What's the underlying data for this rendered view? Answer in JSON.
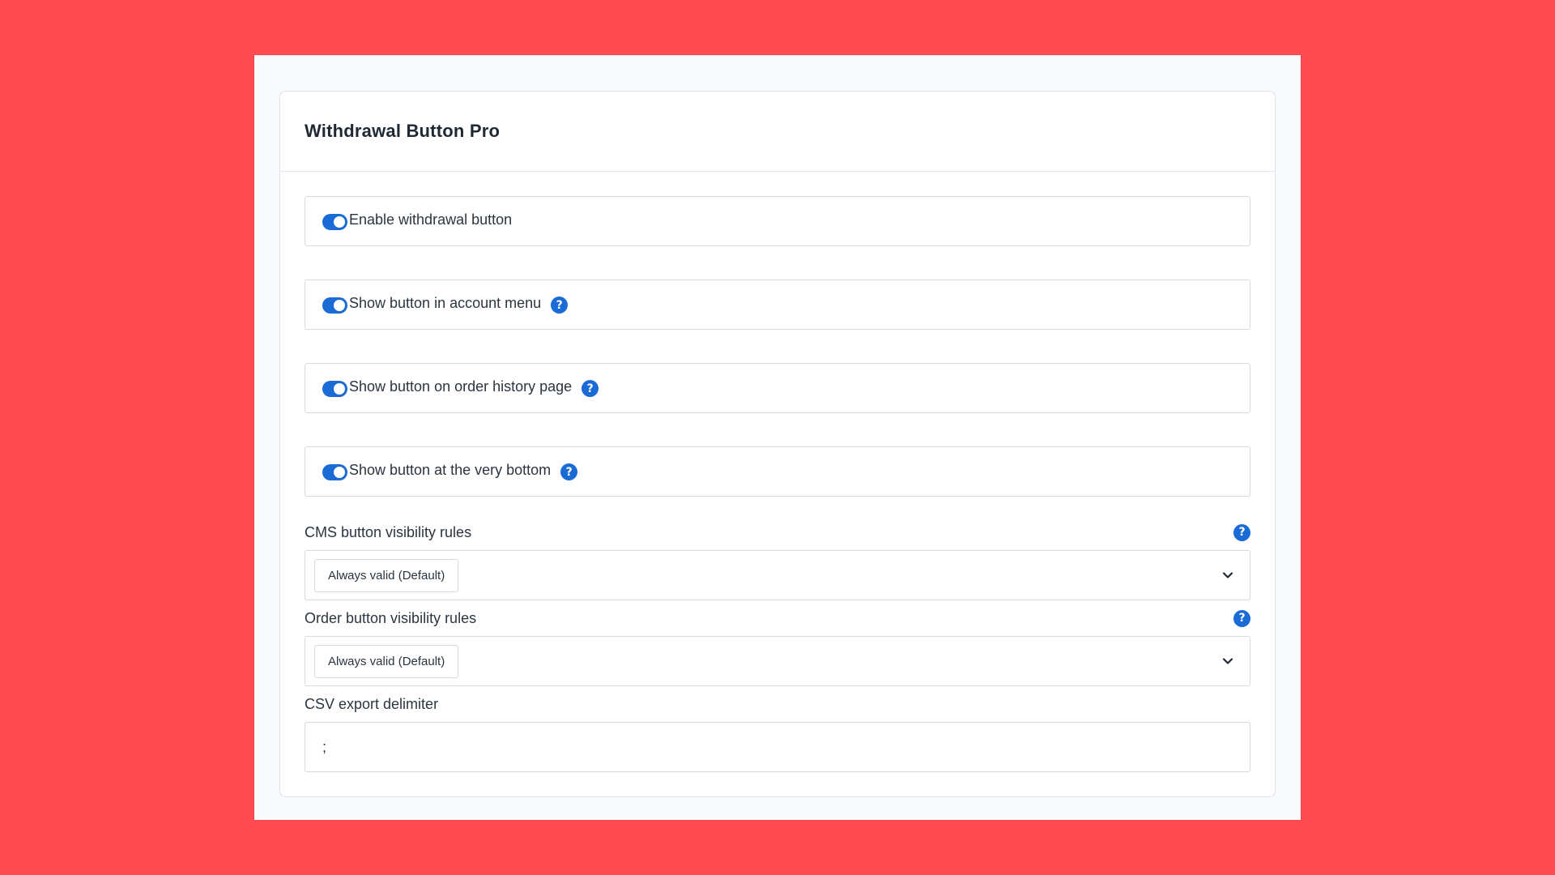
{
  "colors": {
    "backdrop": "#ff4a51",
    "accent": "#1a6bd6"
  },
  "panel": {
    "title": "Withdrawal Button Pro"
  },
  "toggles": [
    {
      "label": "Enable withdrawal button",
      "enabled": true,
      "has_help": false
    },
    {
      "label": "Show button in account menu",
      "enabled": true,
      "has_help": true
    },
    {
      "label": "Show button on order history page",
      "enabled": true,
      "has_help": true
    },
    {
      "label": "Show button at the very bottom",
      "enabled": true,
      "has_help": true
    }
  ],
  "help_icon_glyph": "?",
  "selects": [
    {
      "label": "CMS button visibility rules",
      "value": "Always valid (Default)"
    },
    {
      "label": "Order button visibility rules",
      "value": "Always valid (Default)"
    }
  ],
  "csv": {
    "label": "CSV export delimiter",
    "value": ";"
  },
  "icons": {
    "toggle": "toggle-switch-icon",
    "help": "question-circle-icon",
    "chevron": "chevron-down-icon"
  }
}
